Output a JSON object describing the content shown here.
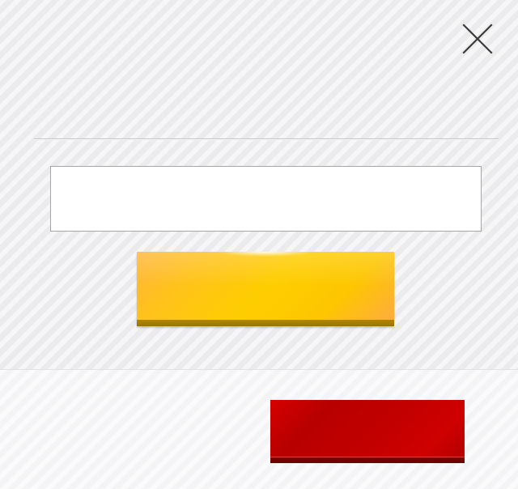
{
  "dialog": {
    "title": "",
    "close_icon": "close-icon",
    "input": {
      "value": "",
      "placeholder": ""
    },
    "primary_button": {
      "label": "",
      "color": "#FECD00"
    },
    "secondary_button": {
      "label": "",
      "color": "#C40000"
    },
    "colors": {
      "background": "#EBEBED",
      "divider": "#C4C4C8",
      "input_border": "#A6A6A8"
    }
  }
}
